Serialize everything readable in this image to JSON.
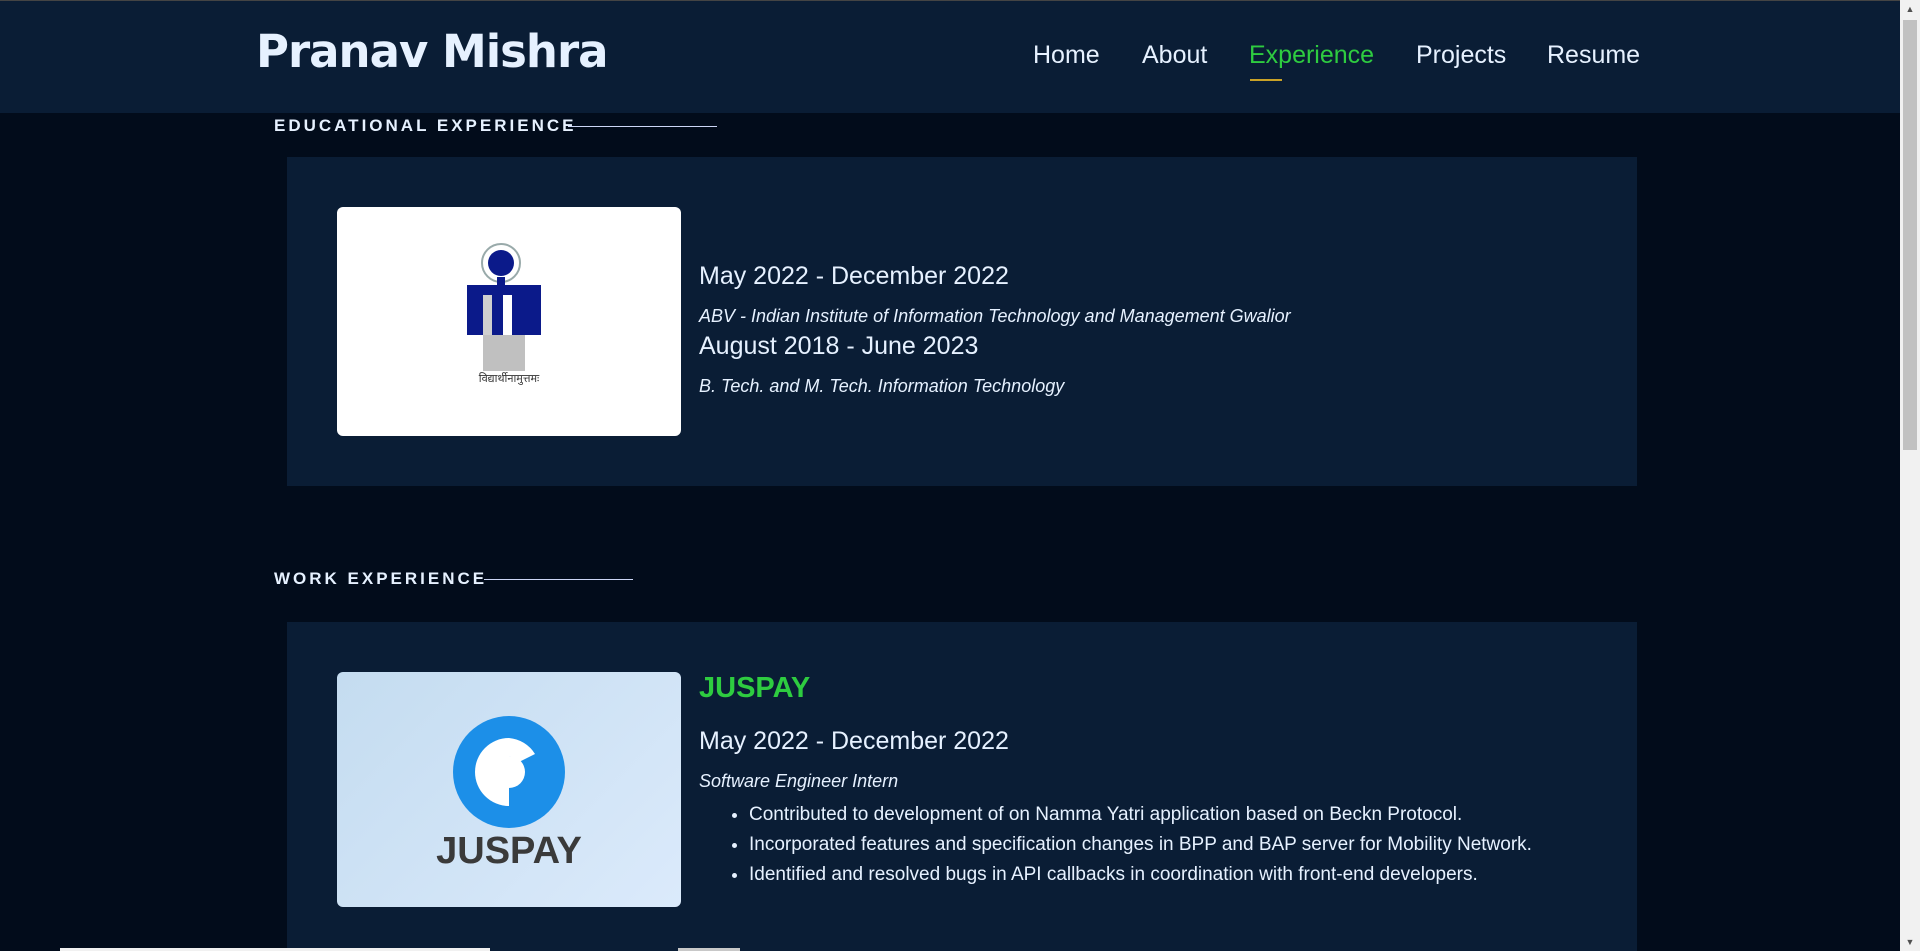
{
  "header": {
    "brand": "Pranav Mishra",
    "nav": [
      "Home",
      "About",
      "Experience",
      "Projects",
      "Resume"
    ],
    "active_nav": "Experience"
  },
  "education": {
    "section_title": "EDUCATIONAL EXPERIENCE",
    "logo_icon": "iiitm-gwalior-logo-icon",
    "logo_caption": "विद्यार्थीनामुत्तमः",
    "entries": [
      {
        "date": "May 2022 - December 2022",
        "detail": "ABV - Indian Institute of Information Technology and Management Gwalior"
      },
      {
        "date": "August 2018 - June 2023",
        "detail": "B. Tech. and M. Tech. Information Technology"
      }
    ]
  },
  "work": {
    "section_title": "WORK EXPERIENCE",
    "logo_icon": "juspay-logo-icon",
    "logo_text": "JUSPAY",
    "company": "JUSPAY",
    "date": "May 2022 - December 2022",
    "role": "Software Engineer Intern",
    "bullets": [
      "Contributed to development of on Namma Yatri application based on Beckn Protocol.",
      "Incorporated features and specification changes in BPP and BAP server for Mobility Network.",
      "Identified and resolved bugs in API callbacks in coordination with front-end developers."
    ]
  },
  "colors": {
    "background": "#020c1b",
    "panel": "#0a1d35",
    "accent_green": "#2ecc40",
    "text": "#e6f1ff",
    "nav_underline": "#c9a227"
  }
}
